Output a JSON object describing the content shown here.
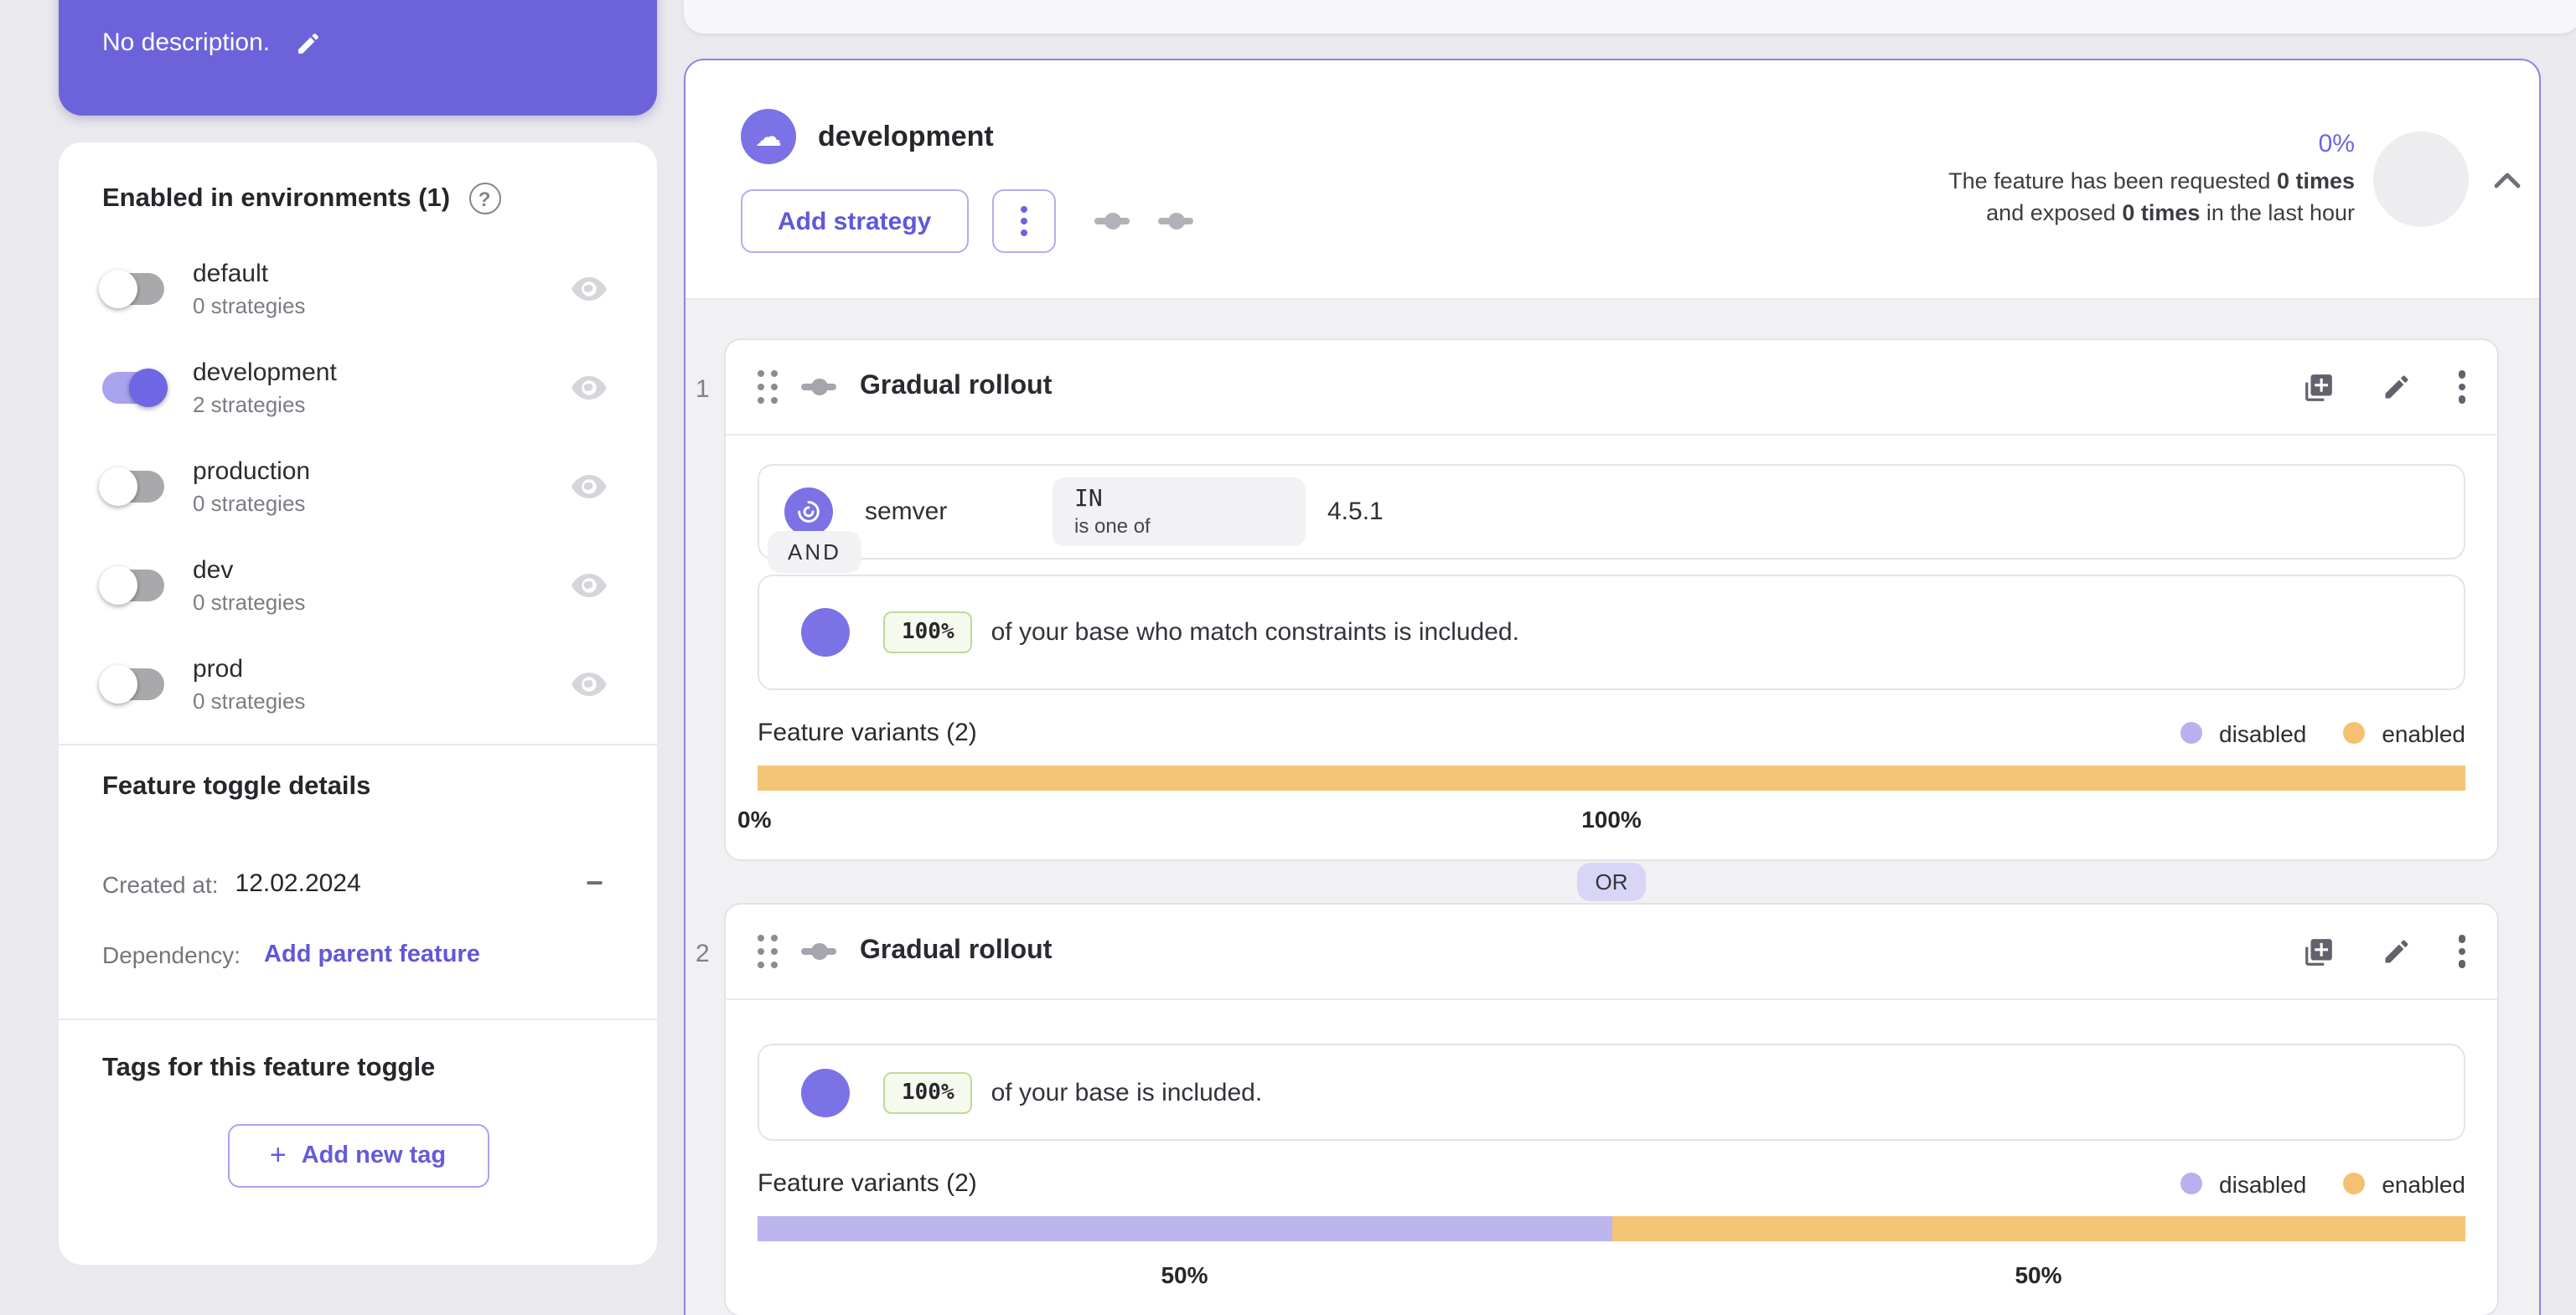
{
  "colors": {
    "accent_purple": "#6c65e1",
    "panel_border": "#8c84e0",
    "toggle_on": "#6e66e3",
    "variant_enabled": "#f4c477",
    "variant_disabled": "#bcb5ee",
    "page_background": "#eae9ee"
  },
  "description_card": {
    "text": "No description.",
    "edit_icon": "pencil-icon"
  },
  "environments_card": {
    "title": "Enabled in environments (1)",
    "help_icon": "question-mark-icon",
    "items": [
      {
        "name": "default",
        "strategies": "0 strategies",
        "enabled": false
      },
      {
        "name": "development",
        "strategies": "2 strategies",
        "enabled": true
      },
      {
        "name": "production",
        "strategies": "0 strategies",
        "enabled": false
      },
      {
        "name": "dev",
        "strategies": "0 strategies",
        "enabled": false
      },
      {
        "name": "prod",
        "strategies": "0 strategies",
        "enabled": false
      }
    ]
  },
  "details_card": {
    "title": "Feature toggle details",
    "created_label": "Created at:",
    "created_value": "12.02.2024",
    "dependency_label": "Dependency:",
    "dependency_action": "Add parent feature",
    "collapse_glyph": "−"
  },
  "tags_card": {
    "title": "Tags for this feature toggle",
    "add_button": "Add new tag",
    "plus_glyph": "+"
  },
  "environment_panel": {
    "name": "development",
    "add_strategy_label": "Add strategy",
    "metrics": {
      "percent": "0%",
      "line1_prefix": "The feature has been requested ",
      "line1_bold": "0 times",
      "line2_prefix": "and exposed ",
      "line2_bold": "0 times",
      "line2_suffix": " in the last hour"
    },
    "separator": "OR",
    "strategies": [
      {
        "index": "1",
        "title": "Gradual rollout",
        "constraint": {
          "context_field": "semver",
          "operator": "IN",
          "operator_description": "is one of",
          "value": "4.5.1"
        },
        "conjunction": "AND",
        "rollout": {
          "percentage": "100%",
          "text": "of your base who match constraints is included."
        },
        "variants": {
          "label": "Feature variants (2)",
          "legend": [
            "disabled",
            "enabled"
          ],
          "bar": [
            {
              "name": "enabled",
              "value": 100
            }
          ],
          "axis": {
            "left": "0%",
            "center": "100%"
          }
        }
      },
      {
        "index": "2",
        "title": "Gradual rollout",
        "rollout": {
          "percentage": "100%",
          "text": "of your base is included."
        },
        "variants": {
          "label": "Feature variants (2)",
          "legend": [
            "disabled",
            "enabled"
          ],
          "bar": [
            {
              "name": "disabled",
              "value": 50
            },
            {
              "name": "enabled",
              "value": 50
            }
          ],
          "halves": [
            "50%",
            "50%"
          ]
        }
      }
    ]
  }
}
